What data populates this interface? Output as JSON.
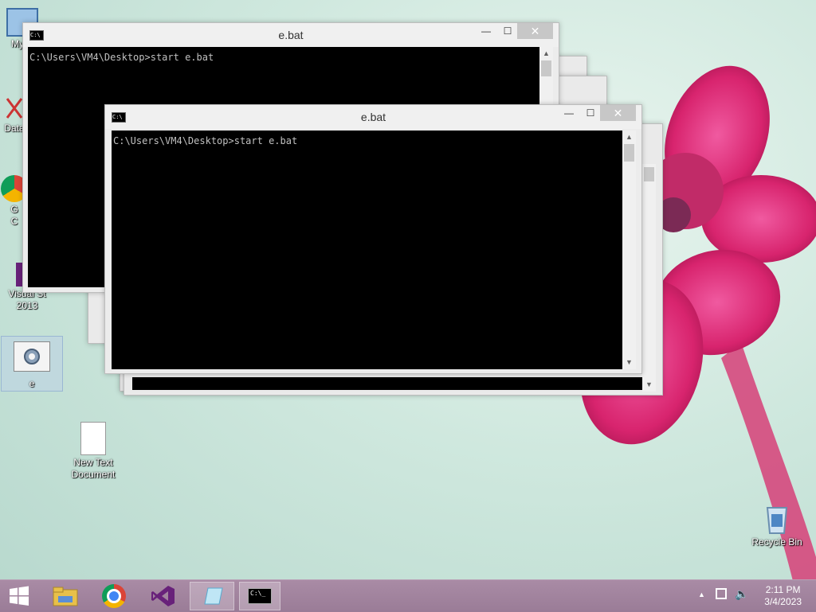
{
  "desktop": {
    "icons": [
      {
        "label": "My C"
      },
      {
        "label": "Data"
      },
      {
        "label": "G\nC"
      },
      {
        "label": "Visual St\n2013"
      },
      {
        "label": "e"
      },
      {
        "label": "New Text\nDocument"
      },
      {
        "label": "Recycle Bin"
      }
    ]
  },
  "windows": {
    "back": {
      "title": "e.bat",
      "console_text": "C:\\Users\\VM4\\Desktop>start e.bat"
    },
    "front": {
      "title": "e.bat",
      "console_text": "C:\\Users\\VM4\\Desktop>start e.bat"
    },
    "minimize_glyph": "—",
    "maximize_glyph": "☐",
    "close_glyph": "✕"
  },
  "taskbar": {
    "clock_time": "2:11 PM",
    "clock_date": "3/4/2023",
    "apps": [
      "start-button",
      "file-explorer",
      "chrome",
      "visual-studio",
      "notepad",
      "command-prompt"
    ]
  },
  "colors": {
    "accent": "#e0357a",
    "taskbar": "#a98ba5"
  }
}
